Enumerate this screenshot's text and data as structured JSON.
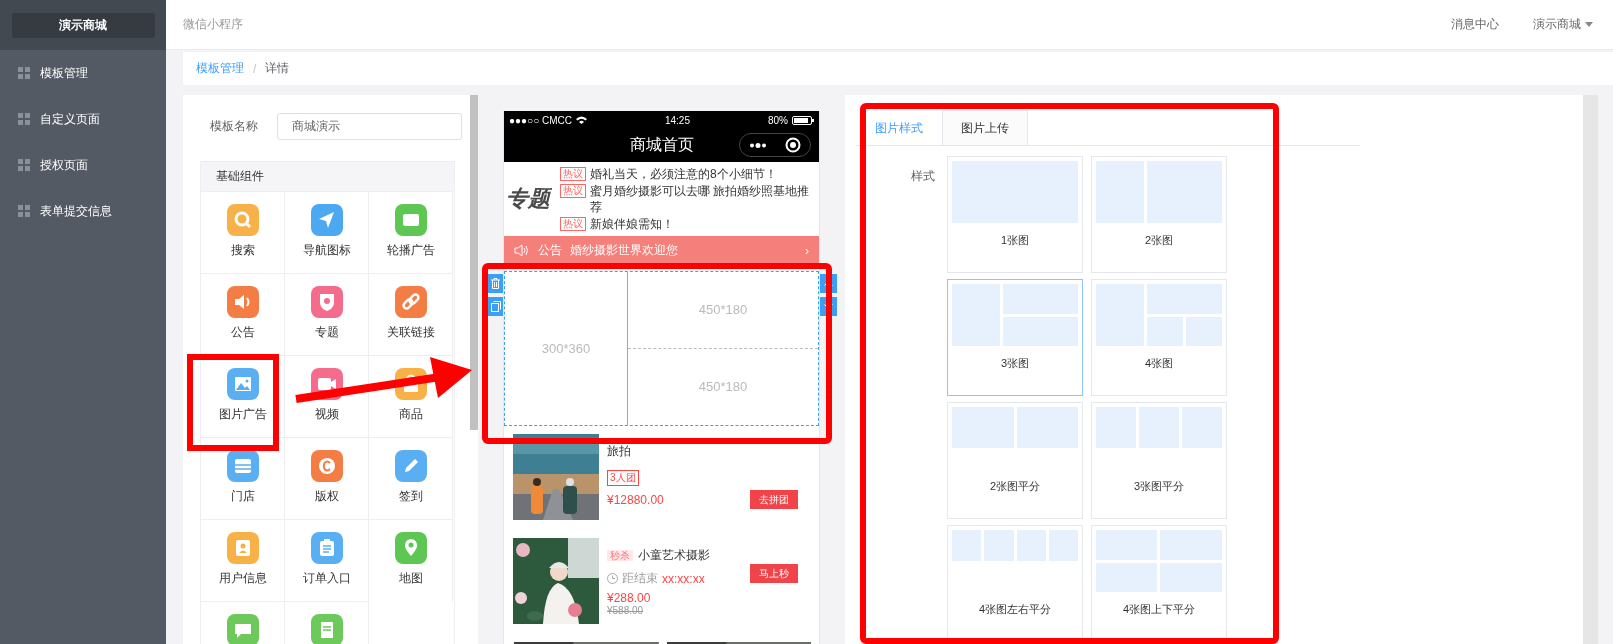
{
  "sidebar": {
    "brand": "演示商城",
    "items": [
      {
        "label": "模板管理"
      },
      {
        "label": "自定义页面"
      },
      {
        "label": "授权页面"
      },
      {
        "label": "表单提交信息"
      }
    ]
  },
  "topbar": {
    "title": "微信小程序",
    "links": [
      "消息中心"
    ],
    "account": "演示商城"
  },
  "breadcrumb": {
    "items": [
      {
        "label": "模板管理",
        "link": true
      },
      {
        "label": "详情",
        "link": false
      }
    ],
    "separator": "/"
  },
  "editor": {
    "name_label": "模板名称",
    "name_value": "商城演示",
    "group_title": "基础组件",
    "components": [
      {
        "label": "搜索",
        "color": "#f8b146"
      },
      {
        "label": "导航图标",
        "color": "#4da8f2"
      },
      {
        "label": "轮播广告",
        "color": "#5ec753"
      },
      {
        "label": "公告",
        "color": "#f47c45"
      },
      {
        "label": "专题",
        "color": "#f46b8c"
      },
      {
        "label": "关联链接",
        "color": "#f47c45"
      },
      {
        "label": "图片广告",
        "color": "#5aaef2"
      },
      {
        "label": "视频",
        "color": "#f46b8c"
      },
      {
        "label": "商品",
        "color": "#f8b146"
      },
      {
        "label": "门店",
        "color": "#5aaef2"
      },
      {
        "label": "版权",
        "color": "#f47c45"
      },
      {
        "label": "签到",
        "color": "#5aaef2"
      },
      {
        "label": "用户信息",
        "color": "#f8b146"
      },
      {
        "label": "订单入口",
        "color": "#5aaef2"
      },
      {
        "label": "地图",
        "color": "#5ec753"
      },
      {
        "color": "#6cc95a"
      },
      {
        "color": "#6cc95a"
      }
    ]
  },
  "phone": {
    "status": {
      "carrier": "●●●○○ CMCC",
      "time": "14:25",
      "battery": "80%"
    },
    "title": "商城首页",
    "topic": {
      "logo": "专题",
      "items": [
        {
          "tag": "热议",
          "text": "婚礼当天，必须注意的8个小细节！"
        },
        {
          "tag": "热议",
          "text": "蜜月婚纱摄影可以去哪 旅拍婚纱照基地推荐"
        },
        {
          "tag": "热议",
          "text": "新娘伴娘需知！"
        }
      ]
    },
    "notice": {
      "label": "公告",
      "text": "婚纱摄影世界欢迎您",
      "arrow": "›"
    },
    "image_ad": {
      "cells": [
        "300*360",
        "450*180",
        "450*180"
      ]
    },
    "products": [
      {
        "kind": "group",
        "title": "旅拍",
        "tag": "3人团",
        "price": "¥12880.00",
        "button": "去拼团"
      },
      {
        "kind": "flash",
        "badge": "秒杀",
        "title": "小童艺术摄影",
        "countdown_label": "距结束",
        "countdown": "xx:xx:xx",
        "price": "¥288.00",
        "old_price": "¥588.00",
        "button": "马上秒"
      }
    ]
  },
  "style_panel": {
    "tabs": [
      {
        "label": "图片样式",
        "selected": true
      },
      {
        "label": "图片上传",
        "selected": false
      }
    ],
    "label": "样式",
    "styles": [
      {
        "label": "1张图",
        "kind": "one",
        "selected": false
      },
      {
        "label": "2张图",
        "kind": "two",
        "selected": false
      },
      {
        "label": "3张图",
        "kind": "three",
        "selected": true
      },
      {
        "label": "4张图",
        "kind": "four",
        "selected": false
      },
      {
        "label": "2张图平分",
        "kind": "two-even",
        "selected": false
      },
      {
        "label": "3张图平分",
        "kind": "three-even",
        "selected": false
      },
      {
        "label": "4张图左右平分",
        "kind": "four-cols",
        "selected": false
      },
      {
        "label": "4张图上下平分",
        "kind": "four-grid",
        "selected": false
      }
    ]
  }
}
